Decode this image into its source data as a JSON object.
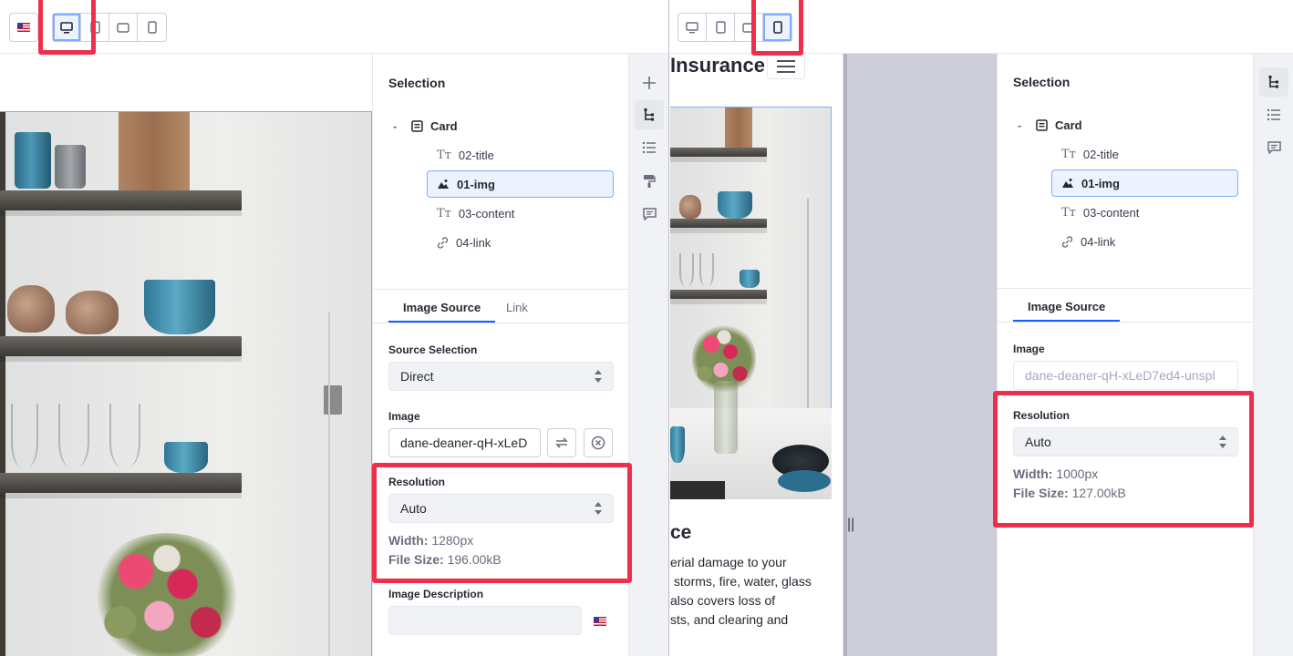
{
  "left": {
    "locale_flag": "us-flag-icon",
    "device_buttons": [
      "desktop-icon",
      "tablet-icon",
      "landscape-phone-icon",
      "portrait-phone-icon"
    ],
    "selection": {
      "title": "Selection",
      "root": "Card",
      "collapse_symbol": "-",
      "items": [
        {
          "label": "02-title",
          "icon": "text-icon"
        },
        {
          "label": "01-img",
          "icon": "image-icon",
          "selected": true
        },
        {
          "label": "03-content",
          "icon": "text-icon"
        },
        {
          "label": "04-link",
          "icon": "link-icon"
        }
      ]
    },
    "tabs": [
      "Image Source",
      "Link"
    ],
    "source_selection": {
      "label": "Source Selection",
      "value": "Direct"
    },
    "image": {
      "label": "Image",
      "value": "dane-deaner-qH-xLeD"
    },
    "resolution": {
      "label": "Resolution",
      "value": "Auto",
      "width_label": "Width:",
      "width_value": "1280px",
      "size_label": "File Size:",
      "size_value": "196.00kB"
    },
    "image_description": {
      "label": "Image Description",
      "value": ""
    },
    "side_icons": [
      "plus-icon",
      "tree-icon",
      "list-icon",
      "paint-roller-icon",
      "comment-icon"
    ]
  },
  "right": {
    "device_buttons": [
      "desktop-icon",
      "tablet-icon",
      "landscape-phone-icon",
      "portrait-phone-icon"
    ],
    "page": {
      "heading": "Insurance",
      "card_title": "ce",
      "card_text": "erial damage to your\n storms, fire, water, glass\nalso covers loss of\nsts, and clearing and"
    },
    "resize_handle": "||",
    "selection": {
      "title": "Selection",
      "root": "Card",
      "collapse_symbol": "-",
      "items": [
        {
          "label": "02-title",
          "icon": "text-icon"
        },
        {
          "label": "01-img",
          "icon": "image-icon",
          "selected": true
        },
        {
          "label": "03-content",
          "icon": "text-icon"
        },
        {
          "label": "04-link",
          "icon": "link-icon"
        }
      ]
    },
    "tabs": [
      "Image Source"
    ],
    "image": {
      "label": "Image",
      "value": "dane-deaner-qH-xLeD7ed4-unspl"
    },
    "resolution": {
      "label": "Resolution",
      "value": "Auto",
      "width_label": "Width:",
      "width_value": "1000px",
      "size_label": "File Size:",
      "size_value": "127.00kB"
    },
    "side_icons": [
      "tree-icon",
      "list-icon",
      "comment-icon"
    ]
  },
  "highlight_color": "#ee2e4d",
  "accent_color": "#0b5fff"
}
